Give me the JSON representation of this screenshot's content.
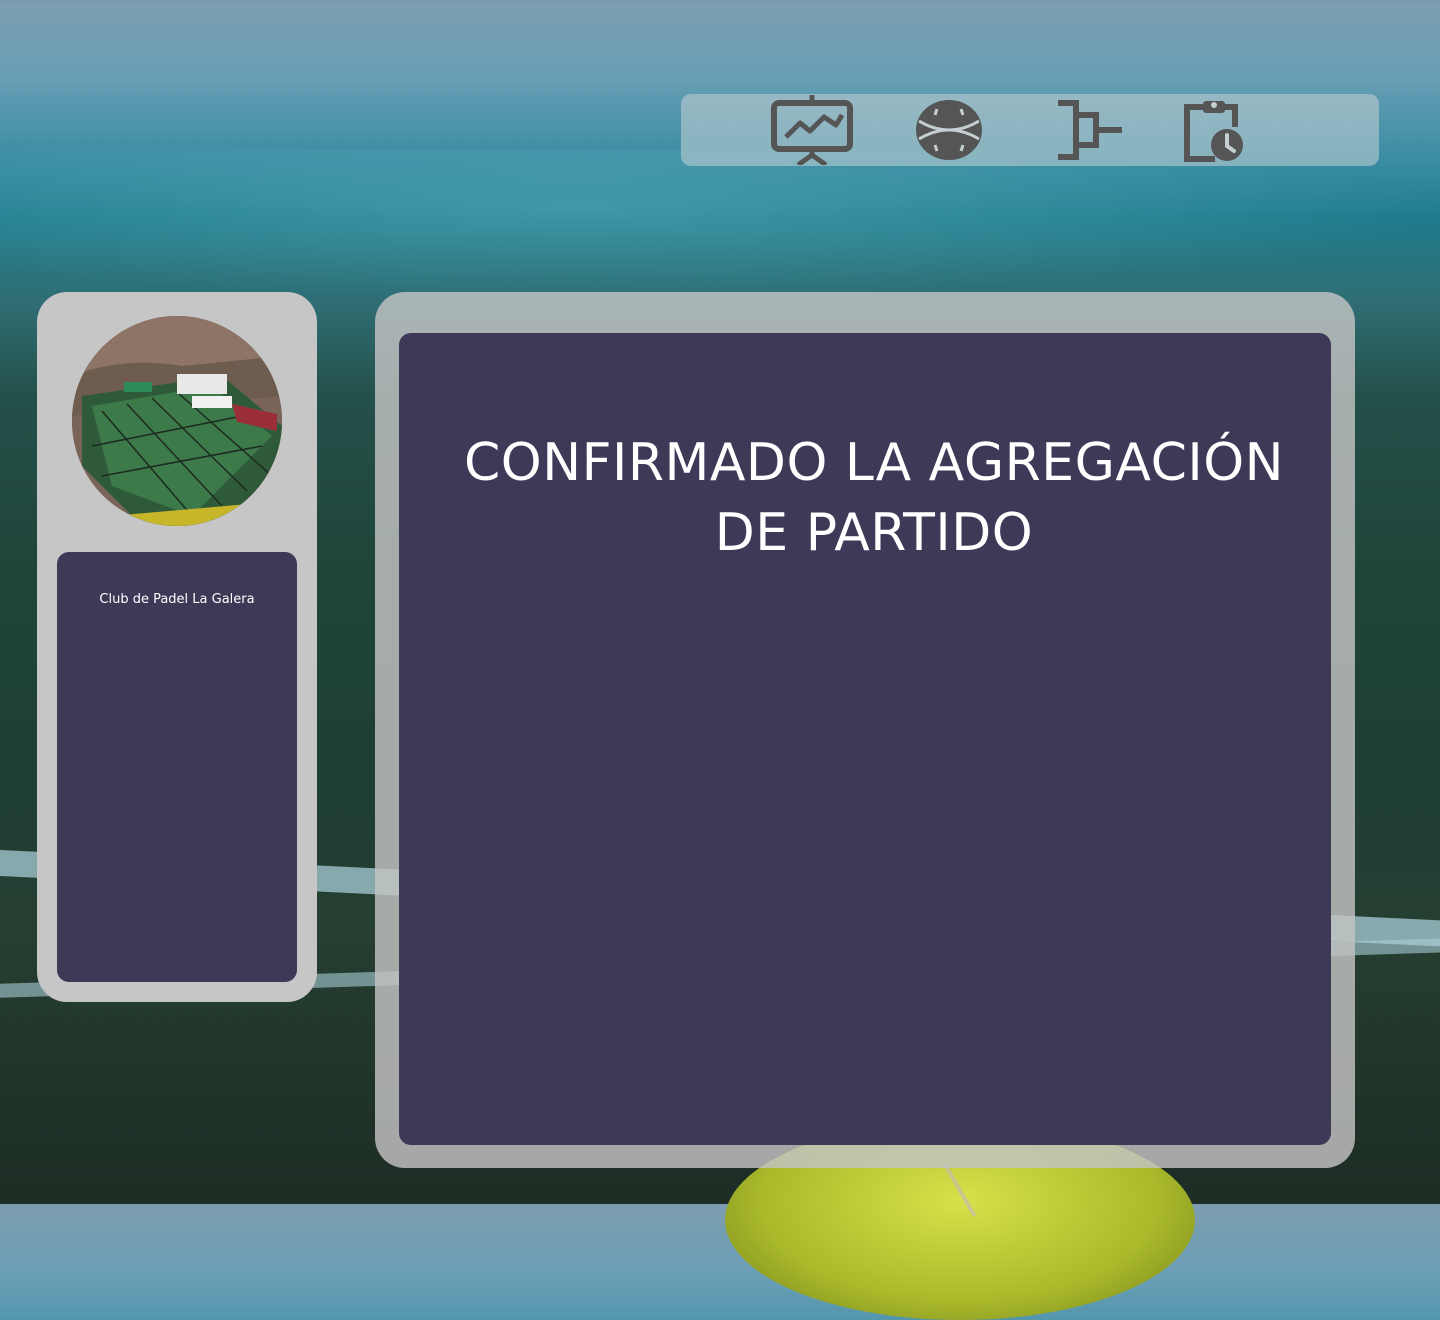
{
  "nav": {
    "items": [
      {
        "icon": "presentation-chart-icon",
        "label": ""
      },
      {
        "icon": "ball-icon",
        "label": ""
      },
      {
        "icon": "tournament-bracket-icon",
        "label": ""
      },
      {
        "icon": "clipboard-clock-icon",
        "label": ""
      }
    ]
  },
  "club": {
    "name": "Club de Padel La Galera",
    "photo_alt": "club-photo"
  },
  "main": {
    "message": "CONFIRMADO LA AGREGACIÓN DE PARTIDO"
  },
  "colors": {
    "panel": "#c6c6c6",
    "inner": "#3d3957",
    "icon": "#555555",
    "text": "#ffffff"
  }
}
